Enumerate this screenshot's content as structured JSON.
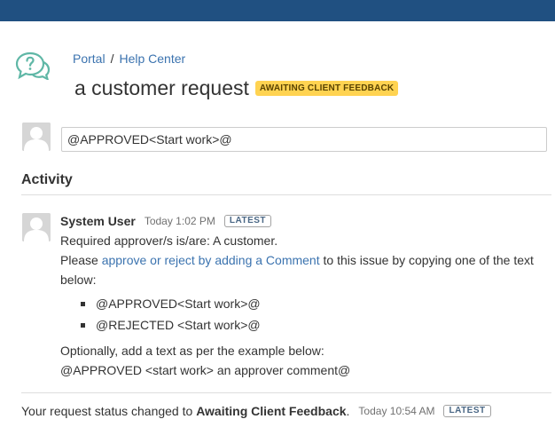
{
  "header": {
    "breadcrumb": [
      "Portal",
      "Help Center"
    ],
    "breadcrumb_separator": "/",
    "title": "a customer request",
    "status": "AWAITING CLIENT FEEDBACK",
    "status_color": "#ffd351"
  },
  "comment_box": {
    "value": "@APPROVED<Start work>@"
  },
  "activity": {
    "heading": "Activity",
    "entries": [
      {
        "author": "System User",
        "time": "Today 1:02 PM",
        "badge": "LATEST",
        "line1": "Required approver/s is/are: A customer.",
        "line2_prefix": "Please ",
        "line2_link": "approve or reject by adding a Comment",
        "line2_suffix": " to this issue by copying one of the text below:",
        "bullets": [
          "@APPROVED<Start work>@",
          "@REJECTED <Start work>@"
        ],
        "line3": "Optionally, add a text as per the example below:",
        "line4": "@APPROVED <start work> an approver comment@"
      }
    ],
    "status_change": {
      "prefix": "Your request status changed to ",
      "status": "Awaiting Client Feedback",
      "suffix": ".",
      "time": "Today 10:54 AM",
      "badge": "LATEST"
    }
  },
  "colors": {
    "topbar": "#205081",
    "link": "#3b73af",
    "help_icon": "#5fb7a6"
  },
  "icons": [
    "help-center-icon",
    "user-avatar-icon"
  ]
}
